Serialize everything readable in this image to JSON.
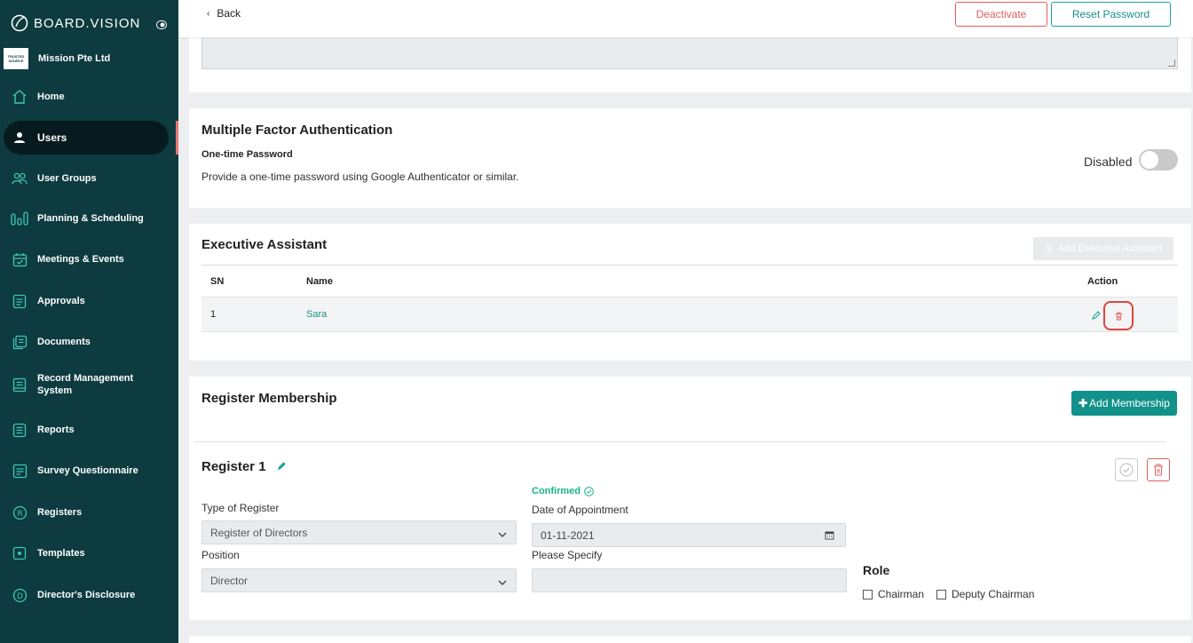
{
  "brand": {
    "name": "BOARD.VISION",
    "org": "Mission Pte Ltd",
    "org_logo_text": "TRUSTED SOURCE"
  },
  "sidebar": {
    "items": [
      {
        "label": "Home",
        "icon": "home-icon"
      },
      {
        "label": "Users",
        "icon": "user-icon",
        "active": true
      },
      {
        "label": "User Groups",
        "icon": "user-groups-icon"
      },
      {
        "label": "Planning & Scheduling",
        "icon": "bar-chart-icon"
      },
      {
        "label": "Meetings & Events",
        "icon": "calendar-check-icon"
      },
      {
        "label": "Approvals",
        "icon": "approvals-icon"
      },
      {
        "label": "Documents",
        "icon": "documents-icon"
      },
      {
        "label": "Record Management System",
        "icon": "records-icon"
      },
      {
        "label": "Reports",
        "icon": "reports-icon"
      },
      {
        "label": "Survey Questionnaire",
        "icon": "survey-icon"
      },
      {
        "label": "Registers",
        "icon": "registers-icon"
      },
      {
        "label": "Templates",
        "icon": "templates-icon"
      },
      {
        "label": "Director's Disclosure",
        "icon": "disclosure-icon"
      }
    ]
  },
  "topbar": {
    "back": "Back",
    "deactivate": "Deactivate",
    "reset_password": "Reset Password"
  },
  "mfa": {
    "title": "Multiple Factor Authentication",
    "subtitle": "One-time Password",
    "description": "Provide a one-time password using Google Authenticator or similar.",
    "status": "Disabled"
  },
  "executive_assistant": {
    "title": "Executive Assistant",
    "add_button": "Add Executive Assistant",
    "columns": {
      "sn": "SN",
      "name": "Name",
      "action": "Action"
    },
    "rows": [
      {
        "sn": "1",
        "name": "Sara"
      }
    ]
  },
  "membership": {
    "title": "Register Membership",
    "add_button": "Add Membership",
    "register": {
      "title": "Register 1",
      "status": "Confirmed",
      "type_label": "Type of Register",
      "type_value": "Register of Directors",
      "date_label": "Date of Appointment",
      "date_value": "01-11-2021",
      "position_label": "Position",
      "position_value": "Director",
      "specify_label": "Please Specify",
      "role_title": "Role",
      "roles": [
        "Chairman",
        "Deputy Chairman"
      ]
    }
  },
  "colors": {
    "sidebar_bg": "#0d3b40",
    "accent": "#12918a",
    "danger": "#e35d5d",
    "confirmed": "#1bb38a"
  }
}
